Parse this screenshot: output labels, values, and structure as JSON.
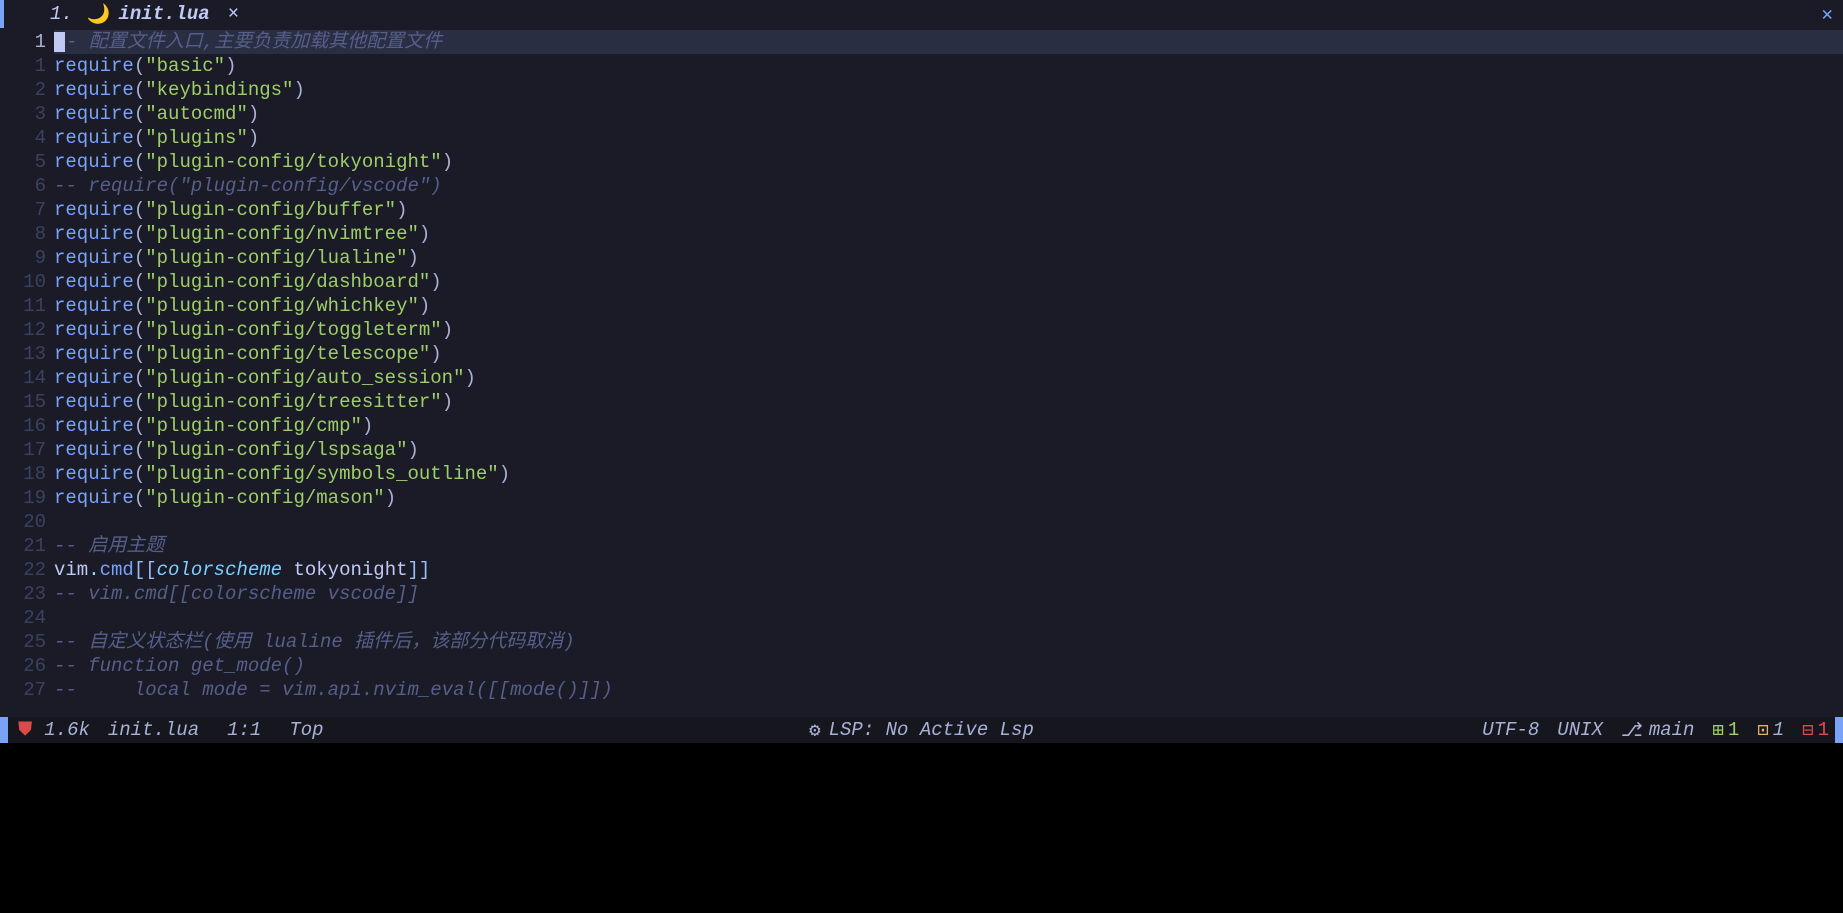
{
  "bufferline": {
    "tab_number": "1.",
    "tab_icon": "🌙",
    "tab_label": "init.lua",
    "close_sym": "×",
    "right_close": "✕"
  },
  "lines": [
    {
      "num": "1",
      "type": "comment-cursor",
      "text": "- 配置文件入口,主要负责加载其他配置文件"
    },
    {
      "num": "1",
      "type": "require",
      "arg": "basic"
    },
    {
      "num": "2",
      "type": "require",
      "arg": "keybindings"
    },
    {
      "num": "3",
      "type": "require",
      "arg": "autocmd"
    },
    {
      "num": "4",
      "type": "require",
      "arg": "plugins"
    },
    {
      "num": "5",
      "type": "require",
      "arg": "plugin-config/tokyonight"
    },
    {
      "num": "6",
      "type": "comment",
      "text": "-- require(\"plugin-config/vscode\")"
    },
    {
      "num": "7",
      "type": "require",
      "arg": "plugin-config/buffer"
    },
    {
      "num": "8",
      "type": "require",
      "arg": "plugin-config/nvimtree"
    },
    {
      "num": "9",
      "type": "require",
      "arg": "plugin-config/lualine"
    },
    {
      "num": "10",
      "type": "require",
      "arg": "plugin-config/dashboard"
    },
    {
      "num": "11",
      "type": "require",
      "arg": "plugin-config/whichkey"
    },
    {
      "num": "12",
      "type": "require",
      "arg": "plugin-config/toggleterm"
    },
    {
      "num": "13",
      "type": "require",
      "arg": "plugin-config/telescope"
    },
    {
      "num": "14",
      "type": "require",
      "arg": "plugin-config/auto_session"
    },
    {
      "num": "15",
      "type": "require",
      "arg": "plugin-config/treesitter"
    },
    {
      "num": "16",
      "type": "require",
      "arg": "plugin-config/cmp"
    },
    {
      "num": "17",
      "type": "require",
      "arg": "plugin-config/lspsaga"
    },
    {
      "num": "18",
      "type": "require",
      "arg": "plugin-config/symbols_outline"
    },
    {
      "num": "19",
      "type": "require",
      "arg": "plugin-config/mason"
    },
    {
      "num": "20",
      "type": "blank",
      "text": ""
    },
    {
      "num": "21",
      "type": "comment",
      "text": "-- 启用主题"
    },
    {
      "num": "22",
      "type": "vimcmd",
      "text_prefix": "vim",
      "dot": ".",
      "cmd": "cmd",
      "br_open": "[[",
      "kw": "colorscheme",
      "val": " tokyonight",
      "br_close": "]]"
    },
    {
      "num": "23",
      "type": "comment",
      "text": "-- vim.cmd[[colorscheme vscode]]"
    },
    {
      "num": "24",
      "type": "blank",
      "text": ""
    },
    {
      "num": "25",
      "type": "comment",
      "text": "-- 自定义状态栏(使用 lualine 插件后，该部分代码取消)"
    },
    {
      "num": "26",
      "type": "comment",
      "text": "-- function get_mode()"
    },
    {
      "num": "27",
      "type": "comment",
      "text": "--     local mode = vim.api.nvim_eval([[mode()]])"
    }
  ],
  "statusline": {
    "shield": "⛊",
    "size": "1.6k",
    "filename": "init.lua",
    "position": "1:1",
    "scroll": "Top",
    "lsp_icon": "⚙",
    "lsp_text": "LSP: No Active Lsp",
    "encoding": "UTF-8",
    "fileformat": "UNIX",
    "branch_icon": "⎇",
    "branch": "main",
    "git_add_sym": "⊞",
    "git_add": "1",
    "git_mod_sym": "⊡",
    "git_mod": "1",
    "git_del_sym": "⊟",
    "git_del": "1"
  }
}
